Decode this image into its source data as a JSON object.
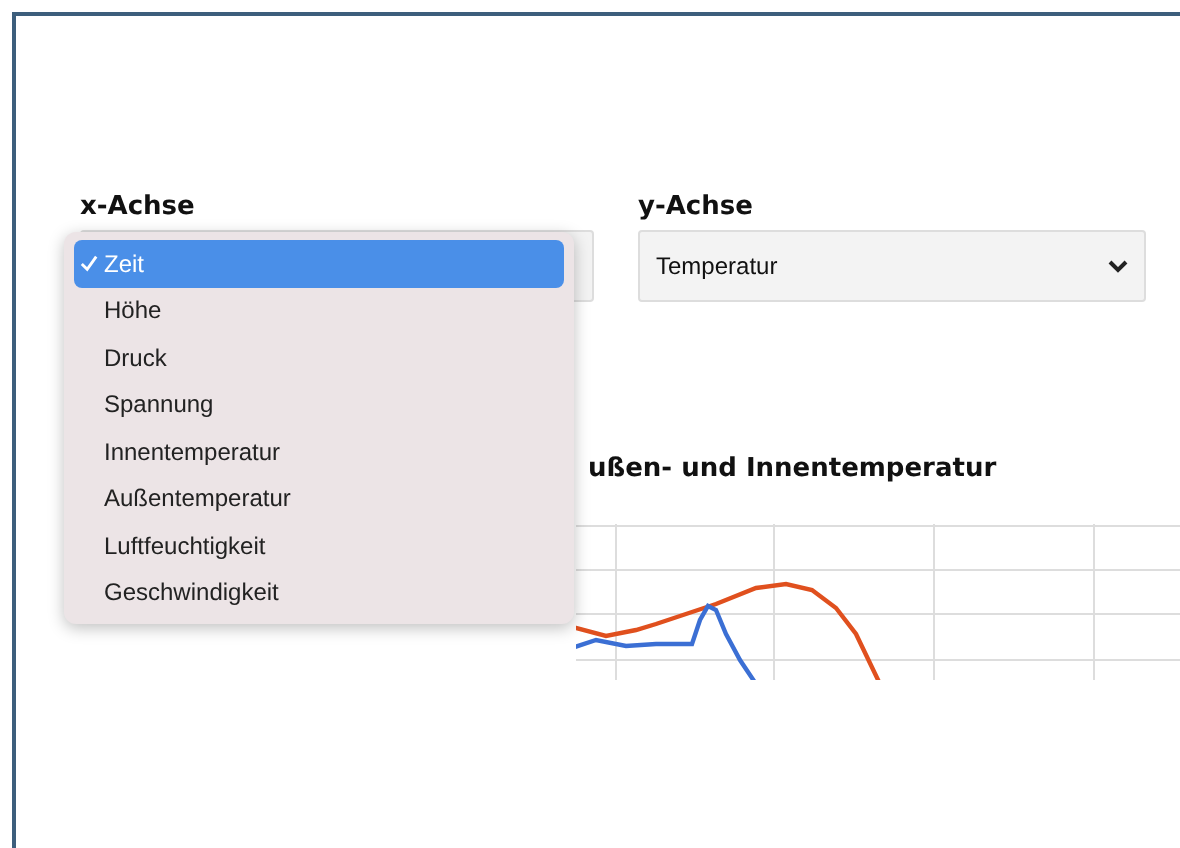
{
  "x_axis": {
    "label": "x-Achse",
    "options": [
      {
        "label": "Zeit",
        "selected": true
      },
      {
        "label": "Höhe",
        "selected": false
      },
      {
        "label": "Druck",
        "selected": false
      },
      {
        "label": "Spannung",
        "selected": false
      },
      {
        "label": "Innentemperatur",
        "selected": false
      },
      {
        "label": "Außentemperatur",
        "selected": false
      },
      {
        "label": "Luftfeuchtigkeit",
        "selected": false
      },
      {
        "label": "Geschwindigkeit",
        "selected": false
      }
    ]
  },
  "y_axis": {
    "label": "y-Achse",
    "value": "Temperatur"
  },
  "chart": {
    "title": "ußen- und Innentemperatur"
  }
}
